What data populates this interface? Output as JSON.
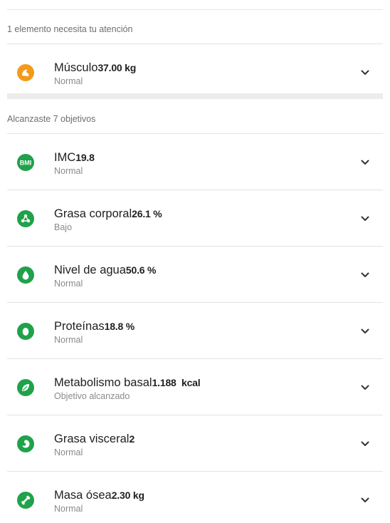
{
  "sections": {
    "attention_header": "1 elemento necesita tu atención",
    "achieved_header": "Alcanzaste 7 objetivos"
  },
  "colors": {
    "green": "#1fa24a",
    "orange": "#f39a1b",
    "band": "#ececec"
  },
  "attention_items": [
    {
      "name": "Músculo",
      "value": "37.00 kg",
      "status": "Normal",
      "icon": "muscle-icon"
    }
  ],
  "achieved_items": [
    {
      "name": "IMC",
      "value": "19.8",
      "status": "Normal",
      "icon": "bmi-icon"
    },
    {
      "name": "Grasa corporal",
      "value": "26.1 %",
      "status": "Bajo",
      "icon": "body-fat-icon"
    },
    {
      "name": "Nivel de agua",
      "value": "50.6 %",
      "status": "Normal",
      "icon": "water-drop-icon"
    },
    {
      "name": "Proteínas",
      "value": "18.8 %",
      "status": "Normal",
      "icon": "protein-icon"
    },
    {
      "name": "Metabolismo basal",
      "value": "1.188  kcal",
      "status": "Objetivo alcanzado",
      "icon": "leaf-icon"
    },
    {
      "name": "Grasa visceral",
      "value": "2",
      "status": "Normal",
      "icon": "visceral-fat-icon"
    },
    {
      "name": "Masa ósea",
      "value": "2.30 kg",
      "status": "Normal",
      "icon": "bone-icon"
    }
  ]
}
